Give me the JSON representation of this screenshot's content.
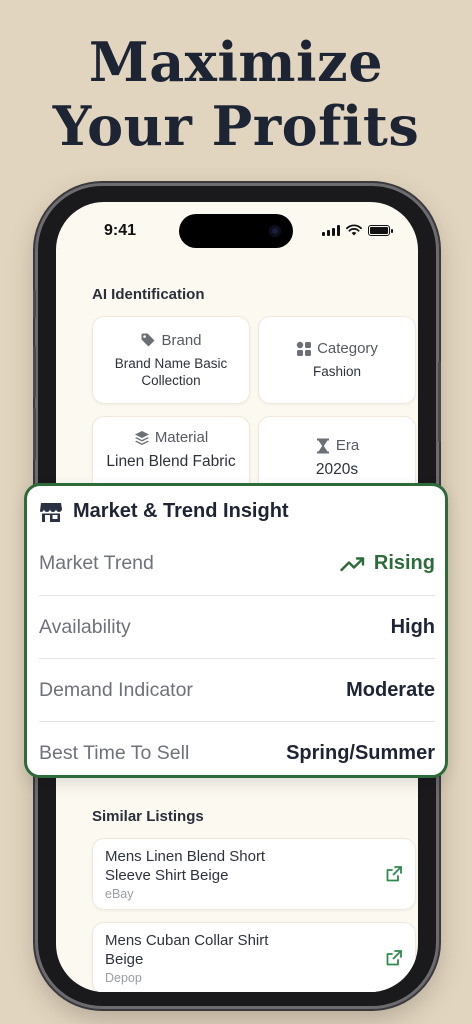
{
  "headline": {
    "line1": "Maximize",
    "line2": "Your Profits"
  },
  "status_bar": {
    "time": "9:41"
  },
  "ai_identification": {
    "title": "AI Identification",
    "cards": [
      {
        "label": "Brand",
        "value": "Brand Name Basic Collection",
        "icon": "tag-icon"
      },
      {
        "label": "Category",
        "value": "Fashion",
        "icon": "grid-icon"
      },
      {
        "label": "Material",
        "value": "Linen Blend Fabric",
        "icon": "layers-icon"
      },
      {
        "label": "Era",
        "value": "2020s",
        "icon": "hourglass-icon"
      }
    ]
  },
  "market": {
    "title": "Market & Trend Insight",
    "icon": "store-icon",
    "rows": [
      {
        "label": "Market Trend",
        "value": "Rising",
        "icon": "trending-up-icon"
      },
      {
        "label": "Availability",
        "value": "High"
      },
      {
        "label": "Demand Indicator",
        "value": "Moderate"
      },
      {
        "label": "Best Time To Sell",
        "value": "Spring/Summer"
      }
    ]
  },
  "similar_listings": {
    "title": "Similar Listings",
    "items": [
      {
        "title": "Mens Linen Blend Short Sleeve Shirt Beige",
        "source": "eBay"
      },
      {
        "title": "Mens Cuban Collar Shirt Beige",
        "source": "Depop"
      }
    ]
  },
  "colors": {
    "background": "#e2d5bf",
    "accent_green": "#2e6b3a",
    "screen": "#fcf9f1",
    "text_dark": "#1e2433"
  }
}
